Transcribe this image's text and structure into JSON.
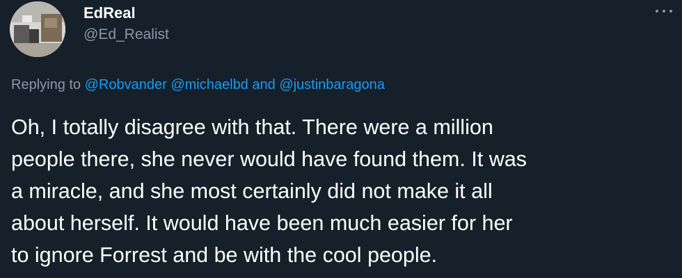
{
  "tweet": {
    "author": {
      "display_name": "EdReal",
      "handle": "@Ed_Realist",
      "avatar_icon": "profile-photo"
    },
    "more_icon": "more-horizontal-icon",
    "reply_context": {
      "prefix": "Replying to",
      "mention_1": "@Robvander",
      "mention_2": "@michaelbd",
      "conjunction": "and",
      "mention_3": "@justinbaragona"
    },
    "body_lines": [
      "Oh, I totally disagree with that. There were a million",
      "people there, she never would have found them. It was",
      "a miracle, and she most certainly did not make it all",
      "about herself. It would have been much easier for her",
      "to ignore Forrest and be with the cool people."
    ]
  },
  "colors": {
    "background": "#15202b",
    "primary_text": "#ffffff",
    "secondary_text": "#8b98a5",
    "link": "#1d9bf0"
  }
}
